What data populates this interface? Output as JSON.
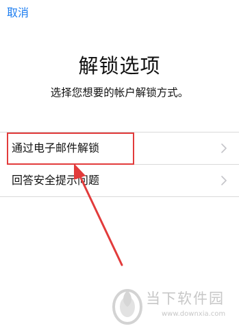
{
  "nav": {
    "cancel_label": "取消"
  },
  "header": {
    "title": "解锁选项",
    "subtitle": "选择您想要的帐户解锁方式。"
  },
  "options": [
    {
      "label": "通过电子邮件解锁",
      "icon": "chevron-right-icon"
    },
    {
      "label": "回答安全提示问题",
      "icon": "chevron-right-icon"
    }
  ],
  "annotation": {
    "color": "#e23b3b"
  },
  "watermark": {
    "name": "当下软件园",
    "url": "www.downxia.com"
  },
  "colors": {
    "accent": "#1a7cf0",
    "divider": "#d9d9d9",
    "chevron": "#c4c4c9",
    "watermark": "#c7c7c7"
  }
}
